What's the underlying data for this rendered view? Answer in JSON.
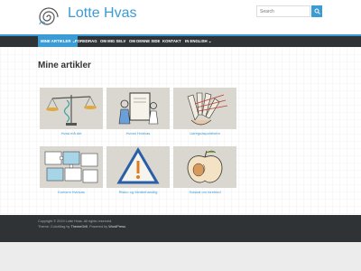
{
  "header": {
    "site_title": "Lotte Hvas",
    "search_placeholder": "Search",
    "logo_icon": "spiral-logo-icon",
    "search_icon": "magnifier-icon"
  },
  "nav": {
    "items": [
      {
        "label": "MINE ARTIKLER",
        "caret": "⌄",
        "active": true
      },
      {
        "label": "FOREDRAG"
      },
      {
        "label": "OM MIG SELV"
      },
      {
        "label": "OM DENNE SIDE"
      },
      {
        "label": "KONTAKT"
      },
      {
        "label": "IN ENGLISH",
        "caret": "⌄"
      }
    ]
  },
  "main": {
    "title": "Mine artikler",
    "articles": [
      {
        "caption": "Hvad må det",
        "image_icon": "balance-scale-icon"
      },
      {
        "caption": "Hvorvi Hvidvas",
        "image_icon": "figures-document-icon"
      },
      {
        "caption": "Udregnaspoldheim",
        "image_icon": "hand-fan-icon"
      },
      {
        "caption": "Komsmi Hvidvas",
        "image_icon": "puzzle-pieces-icon"
      },
      {
        "caption": "Risiko og Medbehandlig",
        "image_icon": "warning-triangle-icon"
      },
      {
        "caption": "Solskal om forebled",
        "image_icon": "apple-icon"
      }
    ]
  },
  "footer": {
    "line1": "Copyright © 2019 Lotte Hvas. All rights reserved.",
    "line2_prefix": "Theme: ColorMag by ",
    "line2_link1": "ThemeGrill",
    "line2_mid": ". Powered by ",
    "line2_link2": "WordPress",
    "line2_suffix": "."
  },
  "colors": {
    "accent": "#3a9bd5",
    "nav_bg": "#2f3335",
    "footer_bg": "#2f3335"
  }
}
